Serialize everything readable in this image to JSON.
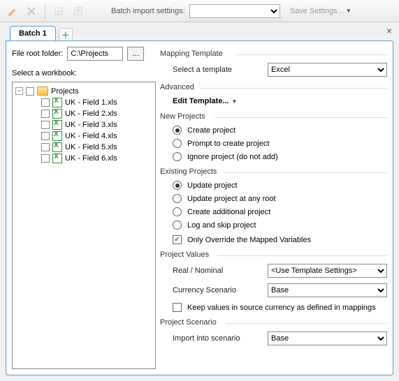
{
  "toolbar": {
    "label": "Batch import settings:",
    "settings_value": "",
    "save_label": "Save Settings..."
  },
  "tabs": {
    "active": "Batch 1"
  },
  "file_root": {
    "label": "File root folder:",
    "value": "C:\\Projects"
  },
  "workbook_label": "Select a workbook:",
  "tree": {
    "root": "Projects",
    "items": [
      "UK - Field 1.xls",
      "UK - Field 2.xls",
      "UK - Field 3.xls",
      "UK - Field 4.xls",
      "UK - Field 5.xls",
      "UK - Field 6.xls"
    ]
  },
  "mapping": {
    "title": "Mapping Template",
    "select_label": "Select a template",
    "template_value": "Excel"
  },
  "advanced": {
    "title": "Advanced",
    "edit_label": "Edit Template..."
  },
  "new_projects": {
    "title": "New Projects",
    "opts": [
      "Create project",
      "Prompt to create project",
      "Ignore project (do not add)"
    ],
    "selected": 0
  },
  "existing_projects": {
    "title": "Existing Projects",
    "opts": [
      "Update project",
      "Update project at any root",
      "Create additional project",
      "Log and skip project"
    ],
    "selected": 0,
    "override_label": "Only Override the Mapped Variables",
    "override_checked": true
  },
  "project_values": {
    "title": "Project Values",
    "real_label": "Real / Nominal",
    "real_value": "<Use Template Settings>",
    "currency_label": "Currency Scenario",
    "currency_value": "Base",
    "keep_label": "Keep values in source currency as defined in mappings",
    "keep_checked": false
  },
  "project_scenario": {
    "title": "Project Scenario",
    "import_label": "Import into scenario",
    "import_value": "Base"
  }
}
